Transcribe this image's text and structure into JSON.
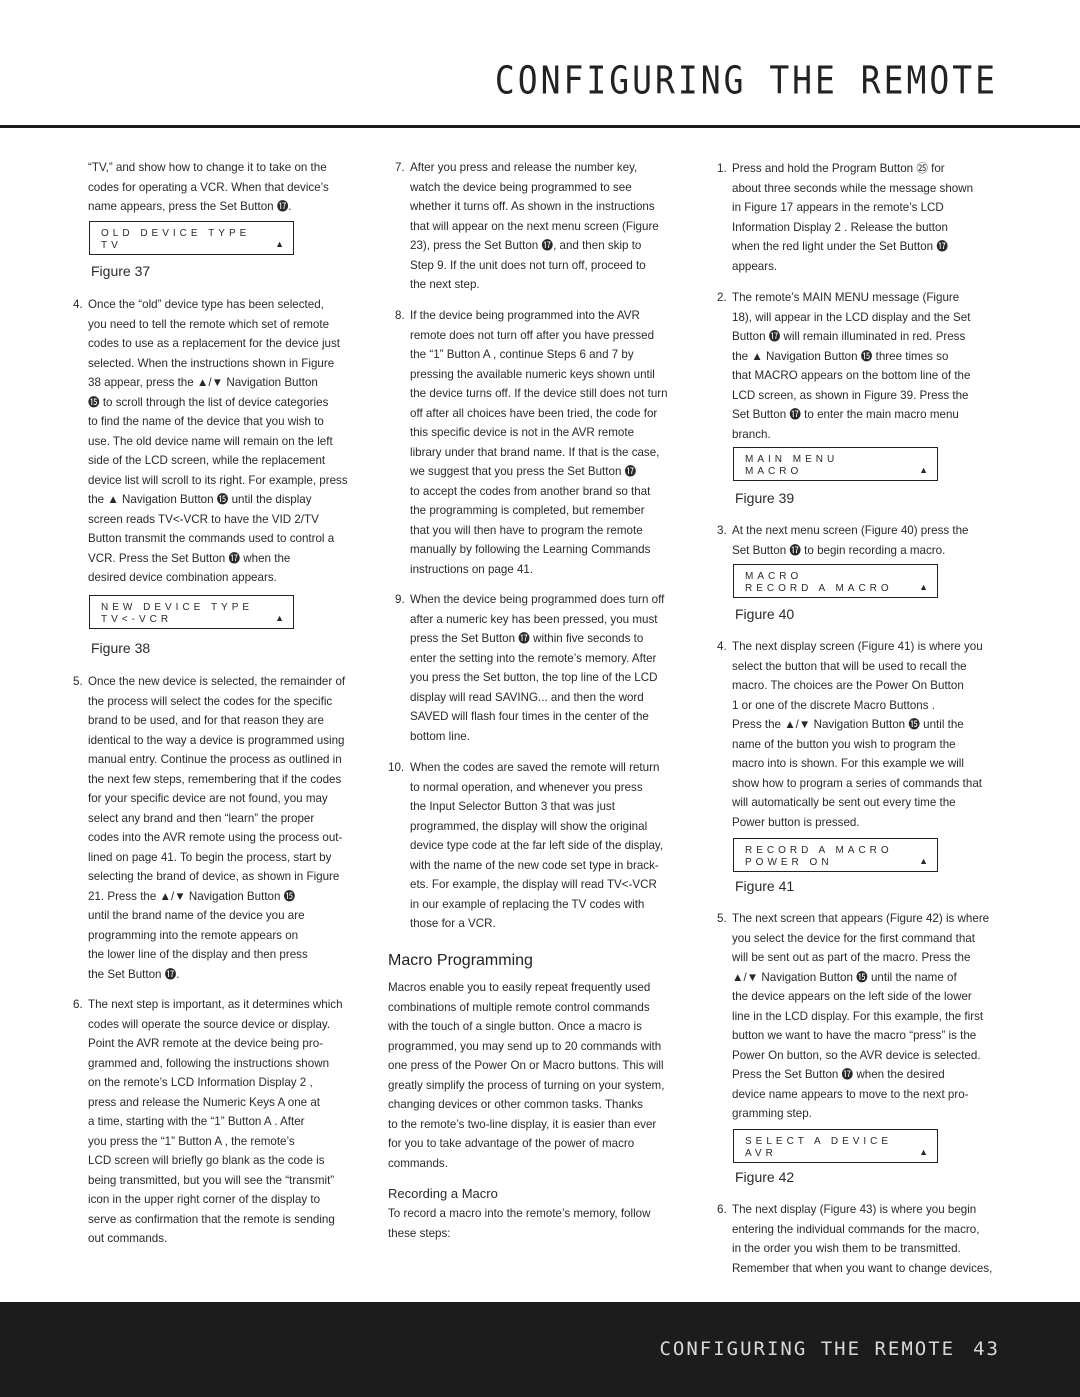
{
  "header": {
    "title": "CONFIGURING THE REMOTE"
  },
  "footer": {
    "title": "CONFIGURING THE REMOTE",
    "page_number": "43"
  },
  "col1": {
    "p0": [
      "“TV,” and show how to change it to take on the",
      "codes for operating a VCR. When that device’s",
      "name appears, press the Set Button ⓱."
    ],
    "fig37": {
      "line1": "OLD DEVICE TYPE",
      "line2": "TV",
      "caption": "Figure 37"
    },
    "item4": {
      "num": "4.",
      "lines": [
        "Once the “old” device type has been selected,",
        "you need to tell the remote which set of remote",
        "codes to use as a replacement for the device just",
        "selected. When the instructions shown in Figure",
        "38 appear, press the ▲/▼ Navigation Button",
        "⓯ to scroll through the list of device categories",
        "to find the name of the device that you wish to",
        "use. The old device name will remain on the left",
        "side of the LCD screen, while the replacement",
        "device list will scroll to its right. For example, press",
        "the ▲ Navigation Button ⓯ until the display",
        "screen reads TV<-VCR to have the VID 2/TV",
        "Button transmit the commands used to control a",
        "VCR. Press the Set Button ⓱ when the",
        "desired device combination appears."
      ]
    },
    "fig38": {
      "line1": "NEW DEVICE TYPE",
      "line2": "TV<-VCR",
      "caption": "Figure 38"
    },
    "item5": {
      "num": "5.",
      "lines": [
        "Once the new device is selected, the remainder of",
        "the process will select the codes for the specific",
        "brand to be used, and for that reason they are",
        "identical to the way a device is programmed using",
        "manual entry. Continue the process as outlined in",
        "the next few steps, remembering that if the codes",
        "for your specific device are not found, you may",
        "select any brand and then “learn” the proper",
        "codes into the AVR remote using the process out-",
        "lined on page 41. To begin the process, start by",
        "selecting the brand of device, as shown in Figure",
        "21. Press the ▲/▼ Navigation Button ⓯",
        "until the brand name of the device you are",
        "programming into the remote appears on",
        "the lower line of the display and then press",
        "the Set Button ⓱."
      ]
    },
    "item6": {
      "num": "6.",
      "lines": [
        "The next step is important, as it determines which",
        "codes will operate the source device or display.",
        "Point the AVR remote at the device being pro-",
        "grammed and, following the instructions shown",
        "on the remote’s LCD Information Display 2 ,",
        "press and release the Numeric Keys A one at",
        "a time, starting with the “1” Button A . After",
        "you press the “1” Button A , the remote’s",
        "LCD screen will briefly go blank as the code is",
        "being transmitted, but you will see the “transmit”",
        "icon in the upper right corner of the display to",
        "serve as confirmation that the remote is sending",
        "out commands."
      ]
    }
  },
  "col2": {
    "item7": {
      "num": "7.",
      "lines": [
        "After you press and release the number key,",
        "watch the device being programmed to see",
        "whether it turns off. As shown in the instructions",
        "that will appear on the next menu screen (Figure",
        "23), press the Set Button ⓱, and then skip to",
        "Step 9. If the unit does not turn off, proceed to",
        "the next step."
      ]
    },
    "item8": {
      "num": "8.",
      "lines": [
        "If the device being programmed into the AVR",
        "remote does not turn off after you have pressed",
        "the “1” Button A , continue Steps 6 and 7 by",
        "pressing the available numeric keys shown until",
        "the device turns off. If the device still does not turn",
        "off after all choices have been tried, the code for",
        "this specific device is not in the AVR remote",
        "library under that brand name. If that is the case,",
        "we suggest that you press the Set Button ⓱",
        "to accept the codes from another brand so that",
        "the programming is completed, but remember",
        "that you will then have to program the remote",
        "manually by following the Learning Commands",
        "instructions on page 41."
      ]
    },
    "item9": {
      "num": "9.",
      "lines": [
        "When the device being programmed does turn off",
        "after a numeric key has been pressed, you must",
        "press the Set Button ⓱ within five seconds to",
        "enter the setting into the remote’s memory. After",
        "you press the Set button, the top line of the LCD",
        "display will read SAVING... and then the word",
        "SAVED will flash four times in the center of the",
        "bottom line."
      ]
    },
    "item10": {
      "num": "10.",
      "lines": [
        "When the codes are saved the remote will return",
        "to normal operation, and whenever you press",
        "the Input Selector Button 3 that was just",
        "programmed, the display will show the original",
        "device type code at the far left side of the display,",
        "with the name of the new code set type in brack-",
        "ets. For example, the display will read TV<-VCR",
        "in our example of replacing the TV codes with",
        "those for a VCR."
      ]
    },
    "macro_heading": "Macro Programming",
    "macro_para": [
      "Macros enable you to easily repeat frequently used",
      "combinations of multiple remote control commands",
      "with the touch of a single button. Once a macro is",
      "programmed, you may send up to 20 commands with",
      "one press of the Power On or Macro buttons. This will",
      "greatly simplify the process of turning on your system,",
      "changing devices or other common tasks. Thanks",
      "to the remote’s two-line display, it is easier than ever",
      "for you to take advantage of the power of macro",
      "commands."
    ],
    "recording_heading": "Recording a Macro",
    "recording_para": [
      "To record a macro into the remote’s memory, follow",
      "these steps:"
    ]
  },
  "col3": {
    "item1": {
      "num": "1.",
      "lines": [
        "Press and hold the Program Button ㉕ for",
        "about three seconds while the message shown",
        "in Figure 17 appears in the remote’s LCD",
        "Information Display 2 . Release the button",
        "when the red light under the Set Button ⓱",
        "appears."
      ]
    },
    "item2": {
      "num": "2.",
      "lines": [
        "The remote’s MAIN MENU message (Figure",
        "18), will appear in the LCD display and the Set",
        "Button ⓱ will remain illuminated in red. Press",
        "the ▲ Navigation Button ⓯ three times so",
        "that MACRO appears on the bottom line of the",
        "LCD screen, as shown in Figure 39. Press the",
        "Set Button ⓱ to enter the main macro menu",
        "branch."
      ]
    },
    "fig39": {
      "line1": "MAIN MENU",
      "line2": "MACRO",
      "caption": "Figure 39"
    },
    "item3": {
      "num": "3.",
      "lines": [
        "At the next menu screen (Figure 40) press the",
        "Set Button ⓱ to begin recording a macro."
      ]
    },
    "fig40": {
      "line1": "MACRO",
      "line2": "RECORD A MACRO",
      "caption": "Figure 40"
    },
    "item4": {
      "num": "4.",
      "lines": [
        "The next display screen (Figure 41) is where you",
        "select the button that will be used to recall the",
        "macro. The choices are the Power On Button",
        "1 or one of the discrete Macro Buttons .",
        "Press the ▲/▼ Navigation Button ⓯ until the",
        "name of the button you wish to program the",
        "macro into is shown. For this example we will",
        "show how to program a series of commands that",
        "will automatically be sent out every time the",
        "Power button is pressed."
      ]
    },
    "fig41": {
      "line1": "RECORD A MACRO",
      "line2": "POWER ON",
      "caption": "Figure 41"
    },
    "item5": {
      "num": "5.",
      "lines": [
        "The next screen that appears (Figure 42) is where",
        "you select the device for the first command that",
        "will be sent out as part of the macro. Press the",
        "▲/▼ Navigation Button ⓯ until the name of",
        "the device appears on the left side of the lower",
        "line in the LCD display. For this example, the first",
        "button we want to have the macro “press” is the",
        "Power On button, so the AVR device is selected.",
        "Press the Set Button ⓱ when the desired",
        "device name appears to move to the next pro-",
        "gramming step."
      ]
    },
    "fig42": {
      "line1": "SELECT A DEVICE",
      "line2": "AVR",
      "caption": "Figure 42"
    },
    "item6": {
      "num": "6.",
      "lines": [
        "The next display (Figure 43) is where you begin",
        "entering the individual commands for the macro,",
        "in the order you wish them to be transmitted.",
        "Remember that when you want to change devices,"
      ]
    }
  },
  "lcd_indicator": "▲"
}
